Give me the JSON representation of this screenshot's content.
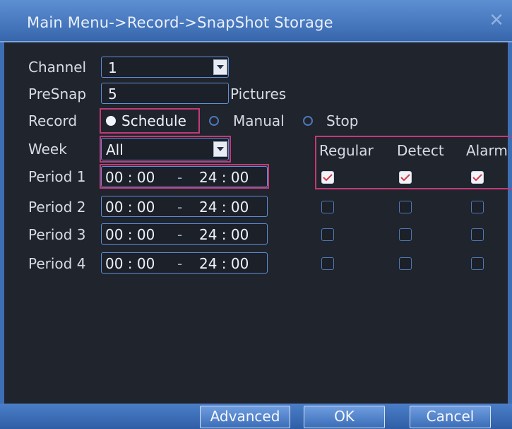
{
  "window": {
    "title": "Main Menu->Record->SnapShot Storage",
    "close_glyph": "✕"
  },
  "form": {
    "channel": {
      "label": "Channel",
      "value": "1"
    },
    "presnap": {
      "label": "PreSnap",
      "value": "5",
      "unit": "Pictures"
    },
    "record": {
      "label": "Record",
      "options": [
        "Schedule",
        "Manual",
        "Stop"
      ],
      "selected": "Schedule"
    },
    "week": {
      "label": "Week",
      "value": "All"
    },
    "columns": [
      "Regular",
      "Detect",
      "Alarm"
    ],
    "periods": [
      {
        "label": "Period 1",
        "start": "00 : 00",
        "sep": "-",
        "end": "24 : 00",
        "regular": true,
        "detect": true,
        "alarm": true
      },
      {
        "label": "Period 2",
        "start": "00 : 00",
        "sep": "-",
        "end": "24 : 00",
        "regular": false,
        "detect": false,
        "alarm": false
      },
      {
        "label": "Period 3",
        "start": "00 : 00",
        "sep": "-",
        "end": "24 : 00",
        "regular": false,
        "detect": false,
        "alarm": false
      },
      {
        "label": "Period 4",
        "start": "00 : 00",
        "sep": "-",
        "end": "24 : 00",
        "regular": false,
        "detect": false,
        "alarm": false
      }
    ]
  },
  "buttons": {
    "advanced": "Advanced",
    "ok": "OK",
    "cancel": "Cancel"
  },
  "colors": {
    "accent": "#3d6fb5",
    "highlight": "#c23a78",
    "check": "#d23a4a"
  }
}
